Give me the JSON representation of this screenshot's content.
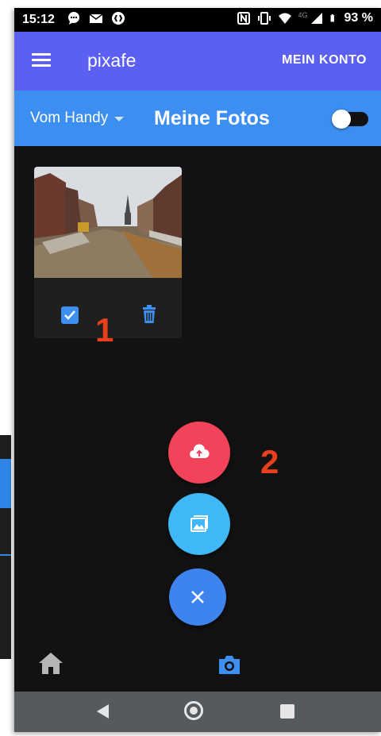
{
  "status_bar": {
    "time": "15:12",
    "battery": "93 %",
    "network_label": "4G",
    "left_icons": [
      "chat-notification-icon",
      "mail-notification-icon",
      "shazam-icon"
    ],
    "right_icons": [
      "nfc-icon",
      "vibrate-icon",
      "wifi-icon",
      "signal-icon",
      "battery-icon"
    ]
  },
  "app_bar": {
    "title": "pixafe",
    "account_label": "MEIN KONTO",
    "menu_icon": "hamburger-menu-icon",
    "color": "#5b5ff2"
  },
  "sub_bar": {
    "source_select": "Vom Handy",
    "section_title": "Meine Fotos",
    "toggle_on": false,
    "color": "#3c8ff0"
  },
  "photos": [
    {
      "checked": true,
      "actions": [
        "checkbox-checked-icon",
        "trash-icon"
      ]
    }
  ],
  "annotations": {
    "one": "1",
    "two": "2",
    "color": "#e8401b"
  },
  "fabs": [
    {
      "name": "upload",
      "icon": "cloud-upload-icon",
      "color": "#f2435a"
    },
    {
      "name": "gallery",
      "icon": "image-gallery-icon",
      "color": "#40b8f5"
    },
    {
      "name": "close",
      "icon": "close-icon",
      "color": "#3d84ee"
    }
  ],
  "bottom_nav": {
    "items": [
      {
        "name": "home",
        "icon": "home-icon",
        "active": false
      },
      {
        "name": "camera",
        "icon": "camera-icon",
        "active": true
      }
    ]
  },
  "system_nav": [
    "back-icon",
    "home-circle-icon",
    "recent-apps-icon"
  ]
}
